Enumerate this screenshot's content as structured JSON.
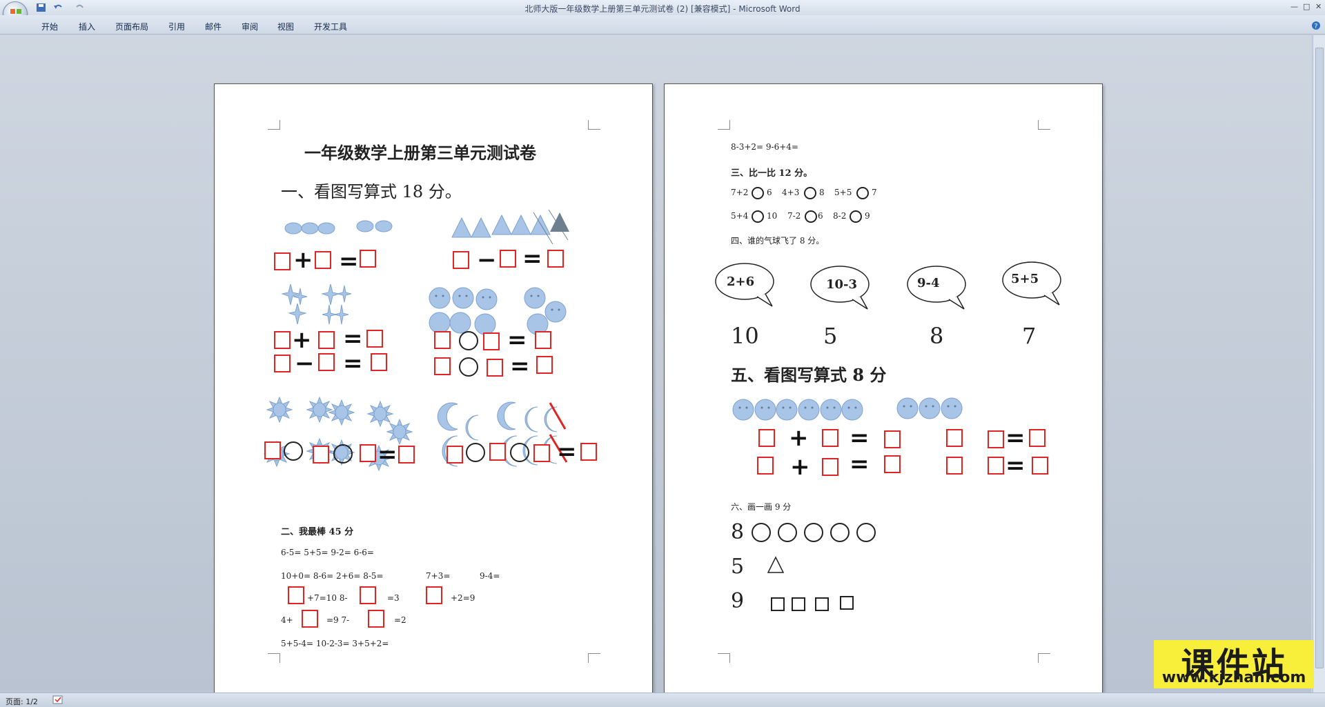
{
  "window": {
    "title": "北师大版一年级数学上册第三单元测试卷 (2) [兼容模式] - Microsoft Word",
    "controls": [
      "—",
      "□",
      "✕"
    ]
  },
  "quick_access": {
    "save_icon": "save-icon",
    "undo_icon": "undo-icon",
    "redo_icon": "redo-icon"
  },
  "ribbon": {
    "tabs": [
      "开始",
      "插入",
      "页面布局",
      "引用",
      "邮件",
      "审阅",
      "视图",
      "开发工具"
    ]
  },
  "page1": {
    "title": "一年级数学上册第三单元测试卷",
    "s1": "一、看图写算式 18 分。",
    "s2": "二、我最棒 45 分",
    "r1": "6-5=   5+5=   9-2=   6-6=",
    "r2a": "10+0=   8-6=   2+6=   8-5=",
    "r2b": "7+3=",
    "r2c": "9-4=",
    "r3a": "+7=10   8-",
    "r3b": "=3",
    "r3c": "+2=9",
    "r4a": "4+",
    "r4b": "=9   7-",
    "r4c": "=2",
    "r5": "5+5-4=   10-2-3=   3+5+2="
  },
  "page2": {
    "r0": "8-3+2=   9-6+4=",
    "s3": "三、比一比 12 分。",
    "c1a": "7+2",
    "c1b": "6",
    "c1c": "4+3",
    "c1d": "8",
    "c1e": "5+5",
    "c1f": "7",
    "c2a": "5+4",
    "c2b": "10",
    "c2c": "7-2",
    "c2d": "6",
    "c2e": "8-2",
    "c2f": "9",
    "s4": "四、谁的气球飞了 8 分。",
    "bubbles": [
      "2+6",
      "10-3",
      "9-4",
      "5+5"
    ],
    "answers": [
      "10",
      "5",
      "8",
      "7"
    ],
    "s5": "五、看图写算式 8 分",
    "s6": "六、画一画 9 分",
    "d1": "8",
    "d2": "5",
    "d3": "9"
  },
  "status": {
    "page": "页面: 1/2"
  },
  "watermark": {
    "title": "课件站",
    "url": "www.kjzhan.com"
  }
}
